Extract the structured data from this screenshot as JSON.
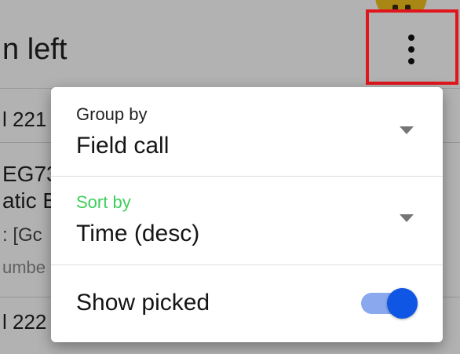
{
  "background": {
    "appbar_title_fragment": "n left",
    "rows": [
      {
        "line1": "l 221"
      },
      {
        "line1": "EG73",
        "line2": "atic E",
        "line3": ": [Gc",
        "line4": "umbe"
      },
      {
        "line1": "l 222"
      }
    ]
  },
  "menu": {
    "group_by": {
      "label": "Group by",
      "value": "Field call"
    },
    "sort_by": {
      "label": "Sort by",
      "value": "Time (desc)"
    },
    "show_picked": {
      "label": "Show picked",
      "checked": true
    }
  },
  "colors": {
    "accent_green": "#3ecf5a",
    "toggle_on": "#0f56e4",
    "toggle_track": "#8aa8ee",
    "highlight": "#e0161d"
  },
  "icons": {
    "overflow": "more-vert-icon",
    "dropdown": "caret-down-icon"
  }
}
